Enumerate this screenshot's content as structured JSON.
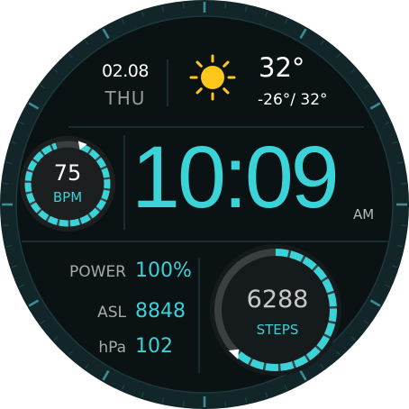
{
  "date": "02.08",
  "weekday": "THU",
  "weather": {
    "icon": "sun-icon",
    "temperature": "32°",
    "range": "-26°/ 32°"
  },
  "time": {
    "display": "10:09",
    "period": "AM"
  },
  "heart_rate": {
    "value": "75",
    "unit": "BPM",
    "progress": 0.9
  },
  "stats": {
    "power_label": "POWER",
    "power_value": "100%",
    "asl_label": "ASL",
    "asl_value": "8848",
    "pressure_label": "hPa",
    "pressure_value": "102"
  },
  "steps": {
    "value": "6288",
    "label": "STEPS",
    "progress": 0.62
  },
  "colors": {
    "accent": "#39d3d8",
    "background": "#0c1416",
    "bezel": "#122528",
    "track": "#3b3f40"
  }
}
